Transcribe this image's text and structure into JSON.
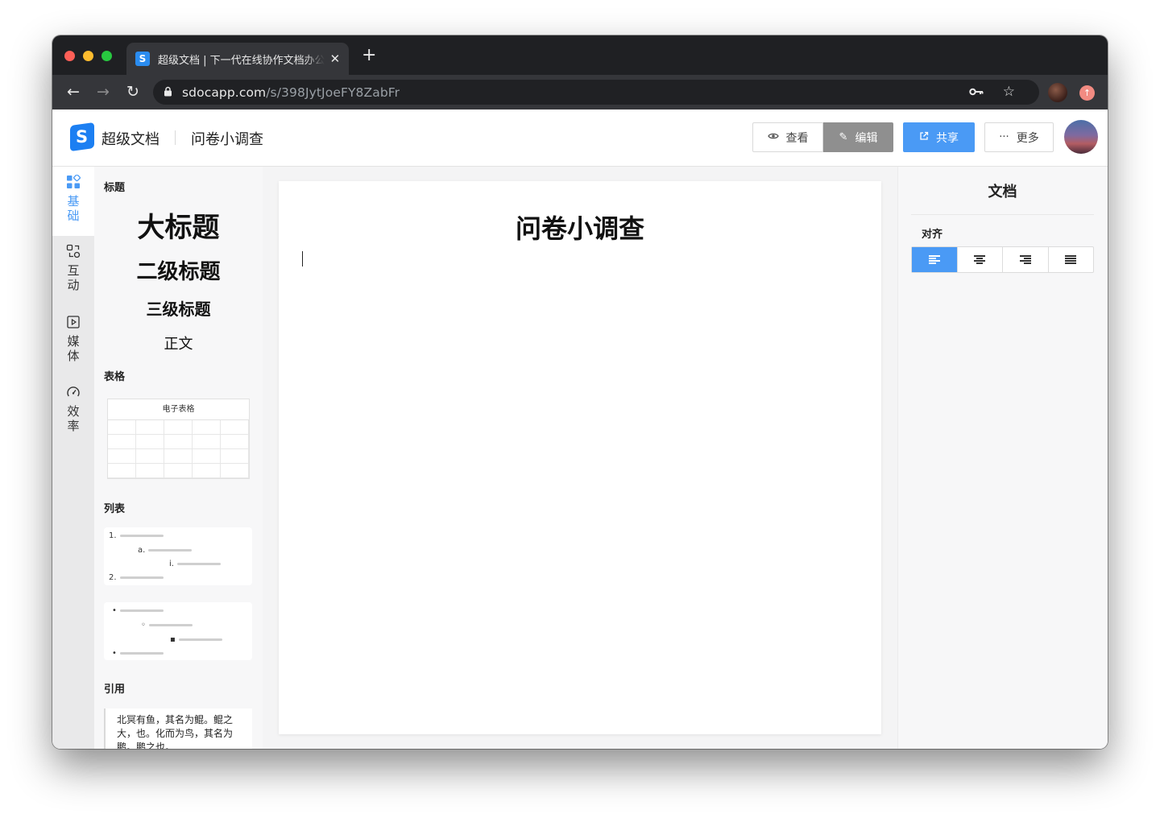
{
  "browser": {
    "tab_title": "超级文档 | 下一代在线协作文档办公平台",
    "favicon": "S",
    "url_host": "sdocapp.com",
    "url_path": "/s/398JytJoeFY8ZabFr"
  },
  "header": {
    "logo_letter": "S",
    "app_name": "超级文档",
    "doc_name": "问卷小调查",
    "buttons": {
      "view": "查看",
      "edit": "编辑",
      "share": "共享",
      "more": "更多"
    }
  },
  "rail": {
    "items": [
      {
        "label": "基础",
        "icon": "blocks-icon",
        "active": true
      },
      {
        "label": "互动",
        "icon": "interact-icon"
      },
      {
        "label": "媒体",
        "icon": "play-icon"
      },
      {
        "label": "效率",
        "icon": "gauge-icon"
      }
    ]
  },
  "panel": {
    "headings_title": "标题",
    "h1": "大标题",
    "h2": "二级标题",
    "h3": "三级标题",
    "body_text": "正文",
    "table_title": "表格",
    "sheet_label": "电子表格",
    "list_title": "列表",
    "ordered_markers": [
      "1.",
      "a.",
      "i.",
      "2."
    ],
    "bullet_markers": [
      "•",
      "◦",
      "▪",
      "•"
    ],
    "quote_title": "引用",
    "quote_text": "北冥有鱼，其名为鲲。鲲之大，也。化而为鸟，其名为鹏。鹏之也。"
  },
  "editor": {
    "title": "问卷小调查"
  },
  "props": {
    "title": "文档",
    "align_label": "对齐",
    "align_options": [
      "align-left-icon",
      "align-center-icon",
      "align-right-icon",
      "align-justify-icon"
    ],
    "align_selected": "align-left-icon"
  },
  "colors": {
    "accent": "#4a9af5",
    "brand": "#1c7ff2",
    "edit_button": "#8f8f8f"
  }
}
